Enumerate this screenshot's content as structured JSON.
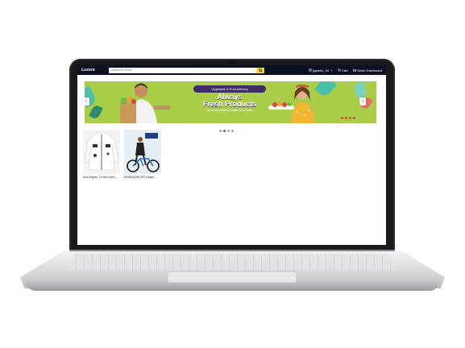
{
  "navbar": {
    "brand": "Luxora",
    "search_placeholder": "Search for items",
    "search_icon": "search-icon",
    "user_label": "jigwebs_04",
    "cart_label": "Cart",
    "seller_label": "Seller Dashboard"
  },
  "banner": {
    "pill": "Vegetable & Fruit delivery",
    "headline_line1": "Always",
    "headline_line2": "Fresh Products",
    "tagline": "All-around delivery within 30 minutes",
    "prev_arrow": "‹",
    "next_arrow": "›",
    "colors": {
      "background": "#a9cd47",
      "pill": "#3f2a6a"
    }
  },
  "carousel": {
    "slide_count": 4,
    "active_index": 1
  },
  "products": [
    {
      "name": "Acid Rights T-Hold Cote L..."
    },
    {
      "name": "MONSOON 26T Gears..."
    }
  ],
  "colors": {
    "navbar": "#0a1022",
    "search_button": "#f5d742"
  }
}
